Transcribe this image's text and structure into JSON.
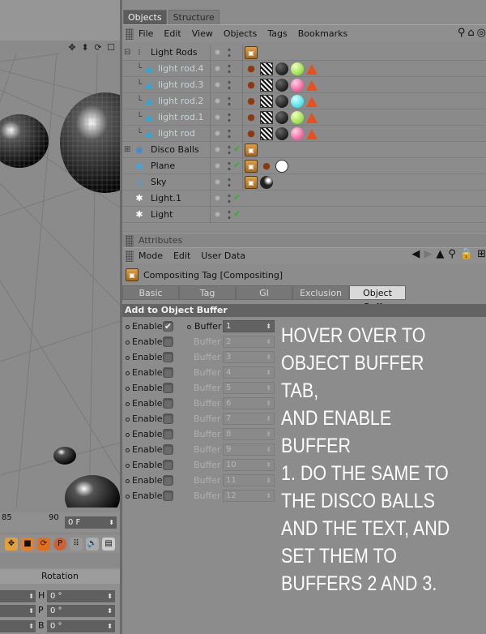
{
  "viewport": {
    "timeline_ticks": [
      "85",
      "90"
    ],
    "frame_field": "0 F",
    "rotation_label": "Rotation",
    "coords": [
      {
        "axis": "H",
        "value": "0 °"
      },
      {
        "axis": "P",
        "value": "0 °"
      },
      {
        "axis": "B",
        "value": "0 °"
      }
    ]
  },
  "object_manager": {
    "tabs": [
      "Objects",
      "Structure"
    ],
    "menu": [
      "File",
      "Edit",
      "View",
      "Objects",
      "Tags",
      "Bookmarks"
    ],
    "objects": [
      {
        "name": "Light Rods",
        "dim": false
      },
      {
        "name": "light rod.4",
        "dim": true
      },
      {
        "name": "light rod.3",
        "dim": true
      },
      {
        "name": "light rod.2",
        "dim": true
      },
      {
        "name": "light rod.1",
        "dim": true
      },
      {
        "name": "light rod",
        "dim": true
      },
      {
        "name": "Disco Balls",
        "dim": false
      },
      {
        "name": "Plane",
        "dim": false
      },
      {
        "name": "Sky",
        "dim": false
      },
      {
        "name": "Light.1",
        "dim": false
      },
      {
        "name": "Light",
        "dim": false
      }
    ]
  },
  "attributes": {
    "title": "Attributes",
    "menu": [
      "Mode",
      "Edit",
      "User Data"
    ],
    "object_title": "Compositing Tag [Compositing]",
    "tabs": [
      "Basic",
      "Tag",
      "GI",
      "Exclusion",
      "Object Buffer"
    ],
    "active_tab": "Object Buffer",
    "section": "Add to Object Buffer",
    "enable_label": "Enable",
    "buffer_label": "Buffer",
    "buffers": [
      {
        "enabled": true,
        "value": "1"
      },
      {
        "enabled": false,
        "value": "2"
      },
      {
        "enabled": false,
        "value": "3"
      },
      {
        "enabled": false,
        "value": "4"
      },
      {
        "enabled": false,
        "value": "5"
      },
      {
        "enabled": false,
        "value": "6"
      },
      {
        "enabled": false,
        "value": "7"
      },
      {
        "enabled": false,
        "value": "8"
      },
      {
        "enabled": false,
        "value": "9"
      },
      {
        "enabled": false,
        "value": "10"
      },
      {
        "enabled": false,
        "value": "11"
      },
      {
        "enabled": false,
        "value": "12"
      }
    ]
  },
  "instruction": "HOVER OVER TO\nOBJECT BUFFER TAB,\nAND ENABLE BUFFER\n1. DO THE SAME TO\nTHE DISCO BALLS\nAND THE TEXT, AND\nSET THEM TO\nBUFFERS 2 AND 3."
}
